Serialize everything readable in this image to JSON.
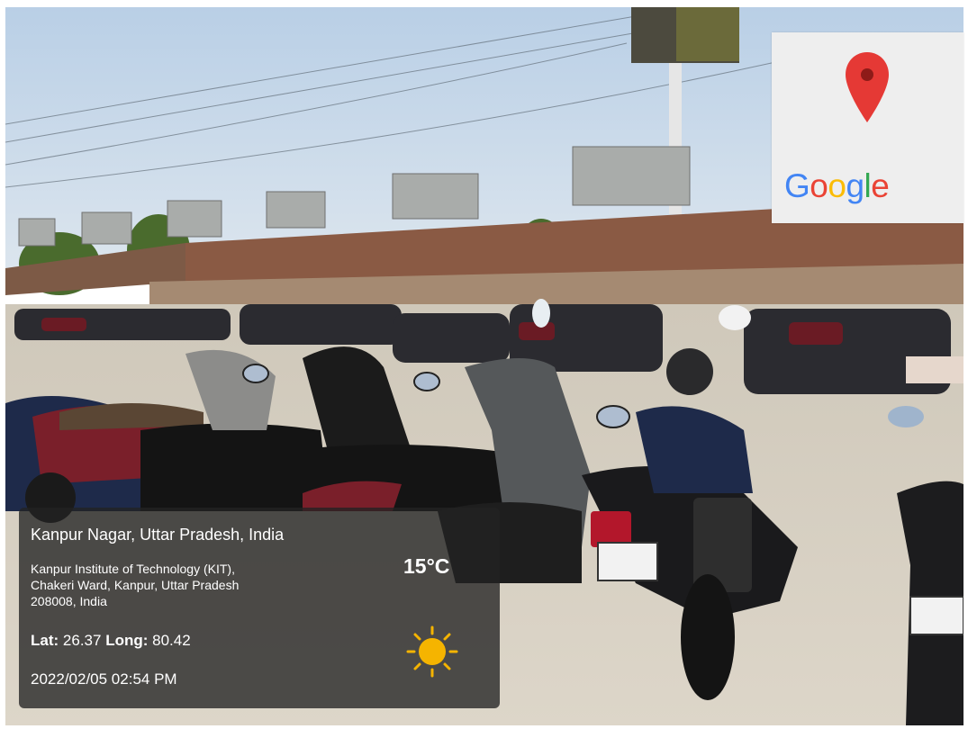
{
  "photo": {
    "description_icon": "parking-lot-photo",
    "sky_color": "#c9d9ea",
    "ground_color": "#d8d1c4",
    "wall_color": "#8a5a44"
  },
  "map_card": {
    "pin_icon": "map-pin-icon",
    "pin_color": "#e53935",
    "logo_letters": [
      {
        "ch": "G",
        "color": "#4285F4"
      },
      {
        "ch": "o",
        "color": "#EA4335"
      },
      {
        "ch": "o",
        "color": "#FBBC05"
      },
      {
        "ch": "g",
        "color": "#4285F4"
      },
      {
        "ch": "l",
        "color": "#34A853"
      },
      {
        "ch": "e",
        "color": "#EA4335"
      }
    ]
  },
  "geotag": {
    "place_title": "Kanpur Nagar, Uttar Pradesh, India",
    "address_lines": [
      "Kanpur Institute of Technology (KIT),",
      "Chakeri Ward, Kanpur, Uttar Pradesh",
      "208008, India"
    ],
    "lat_label": "Lat:",
    "lat_value": "26.37",
    "long_label": "Long:",
    "long_value": "80.42",
    "datetime": "2022/02/05 02:54 PM",
    "temperature": "15°C",
    "weather_icon": "sun-icon",
    "sun_color": "#f5b400"
  }
}
